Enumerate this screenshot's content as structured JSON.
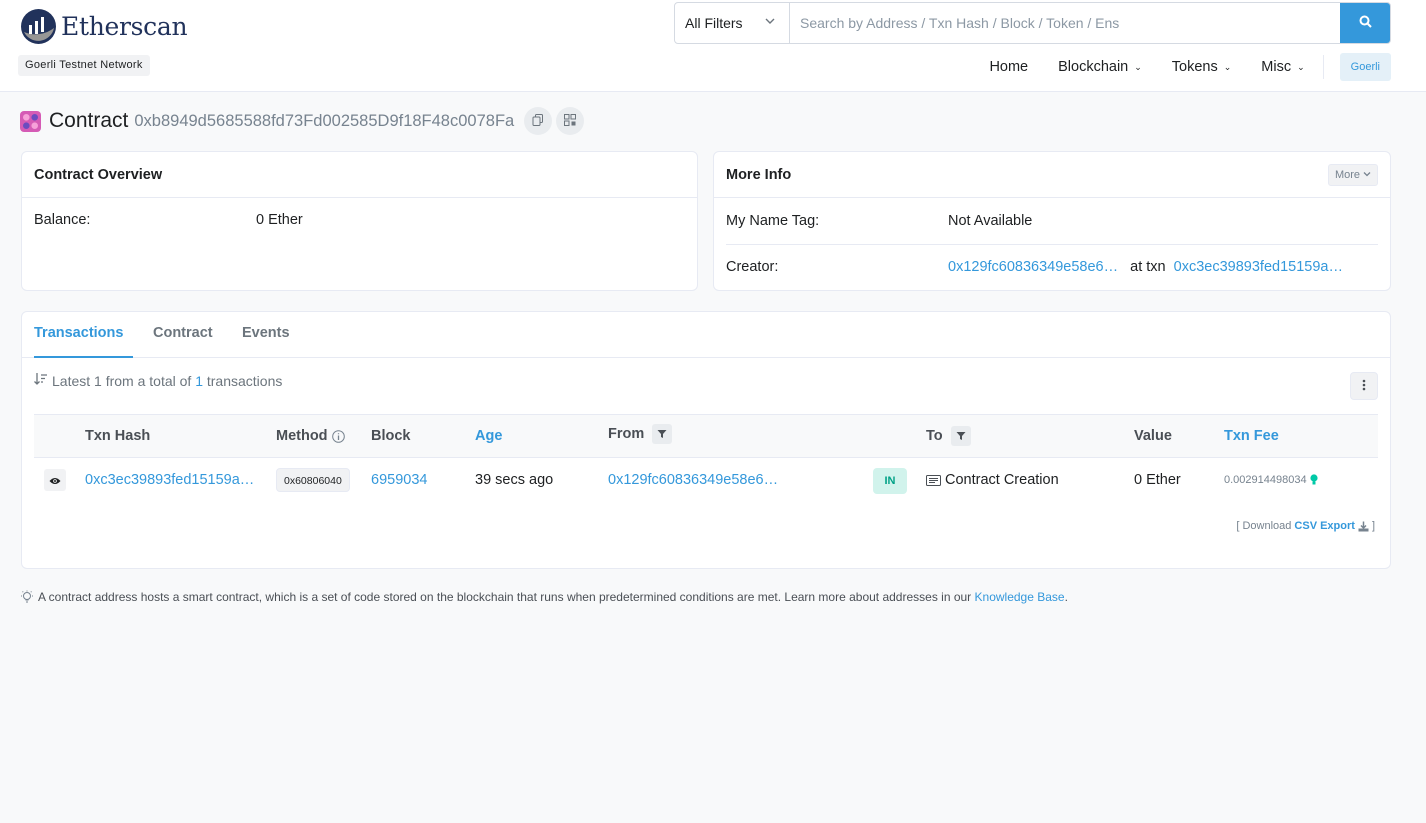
{
  "header": {
    "logo_text": "Etherscan",
    "network_badge": "Goerli Testnet Network",
    "search": {
      "filter_selected": "All Filters",
      "placeholder": "Search by Address / Txn Hash / Block / Token / Ens"
    },
    "nav": {
      "home": "Home",
      "blockchain": "Blockchain",
      "tokens": "Tokens",
      "misc": "Misc",
      "network": "Goerli"
    }
  },
  "page": {
    "title_label": "Contract",
    "address": "0xb8949d5685588fd73Fd002585D9f18F48c0078Fa"
  },
  "overview": {
    "title": "Contract Overview",
    "balance_label": "Balance:",
    "balance_value": "0 Ether"
  },
  "more_info": {
    "title": "More Info",
    "more_button": "More",
    "name_tag_label": "My Name Tag:",
    "name_tag_value": "Not Available",
    "creator_label": "Creator:",
    "creator_address": "0x129fc60836349e58e6…",
    "at_txn": "at txn",
    "creator_txn": "0xc3ec39893fed15159a…"
  },
  "tabs": {
    "transactions": "Transactions",
    "contract": "Contract",
    "events": "Events"
  },
  "summary": {
    "prefix": "Latest 1 from a total of",
    "count": "1",
    "suffix": "transactions"
  },
  "table": {
    "headers": {
      "txn_hash": "Txn Hash",
      "method": "Method",
      "block": "Block",
      "age": "Age",
      "from": "From",
      "to": "To",
      "value": "Value",
      "txn_fee": "Txn Fee"
    },
    "rows": [
      {
        "txn_hash": "0xc3ec39893fed15159a…",
        "method": "0x60806040",
        "block": "6959034",
        "age": "39 secs ago",
        "from": "0x129fc60836349e58e6…",
        "direction": "IN",
        "to": "Contract Creation",
        "value": "0 Ether",
        "txn_fee": "0.002914498034"
      }
    ]
  },
  "download": {
    "open": "[ Download",
    "link": "CSV Export",
    "close": "]"
  },
  "footer_note": {
    "text": "A contract address hosts a smart contract, which is a set of code stored on the blockchain that runs when predetermined conditions are met. Learn more about addresses in our",
    "link": "Knowledge Base",
    "end": "."
  },
  "colors": {
    "accent": "#3498db",
    "in_badge_bg": "#d1f3ec",
    "in_badge_text": "#00a186"
  }
}
